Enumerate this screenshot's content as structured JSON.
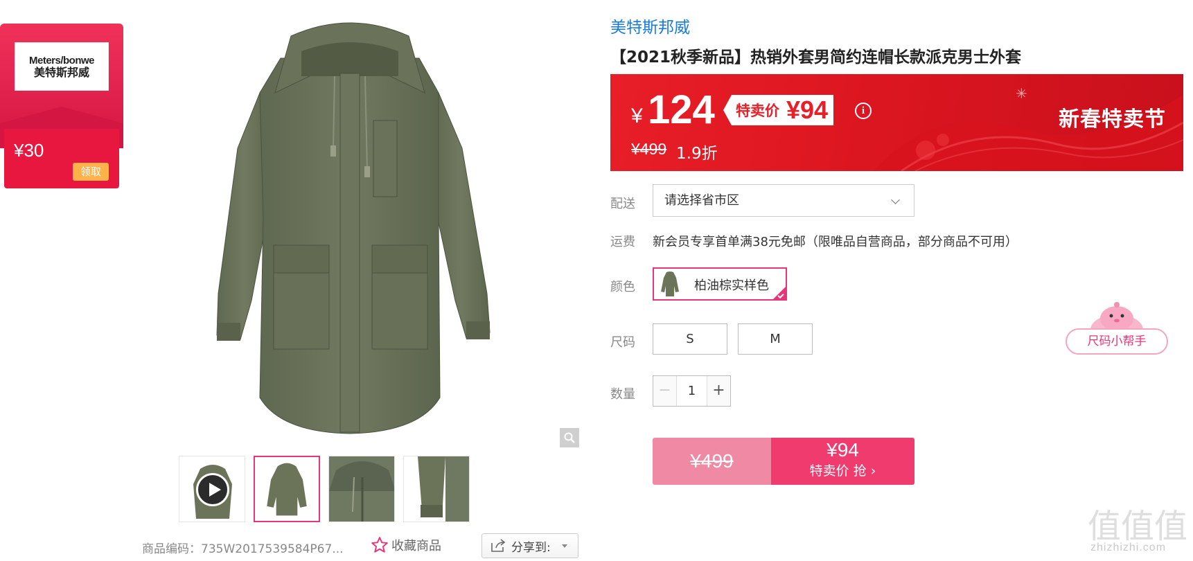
{
  "coupon": {
    "brand_logo_en": "Meters/bonwe",
    "brand_logo_cn": "美特斯邦威",
    "amount": "¥30",
    "claim_label": "领取"
  },
  "product": {
    "brand": "美特斯邦威",
    "title": "【2021秋季新品】热销外套男简约连帽长款派克男士外套"
  },
  "price": {
    "currency": "¥",
    "current": "124",
    "special_label": "特卖价",
    "special_price": "¥94",
    "info_icon_glyph": "i",
    "original": "¥499",
    "discount": "1.9折",
    "festival": "新春特卖节"
  },
  "delivery": {
    "label": "配送",
    "placeholder": "请选择省市区"
  },
  "shipping": {
    "label": "运费",
    "text": "新会员专享首单满38元免邮（限唯品自营商品，部分商品不可用）"
  },
  "color": {
    "label": "颜色",
    "selected": "柏油棕实样色"
  },
  "size": {
    "label": "尺码",
    "options": [
      "S",
      "M"
    ]
  },
  "quantity": {
    "label": "数量",
    "value": "1",
    "minus": "−",
    "plus": "+"
  },
  "buy": {
    "original": "¥499",
    "price": "¥94",
    "action": "特卖价 抢 ›"
  },
  "size_helper": {
    "label": "尺码小帮手"
  },
  "meta": {
    "product_code": "商品编码：735W2017539584P67...",
    "favorite": "收藏商品",
    "share": "分享到:"
  },
  "watermark": {
    "text": "zhizhizhi.com",
    "glyphs": "值值值"
  },
  "colors": {
    "accent_pink": "#e8347a",
    "price_red": "#e81e28",
    "brand_blue": "#1a7ad8",
    "coat_green": "#6b7459"
  }
}
